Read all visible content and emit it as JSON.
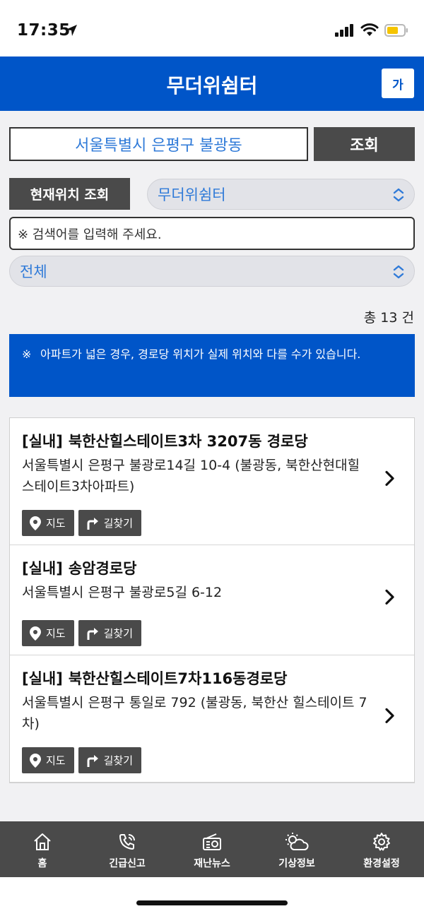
{
  "status_bar": {
    "time": "17:35"
  },
  "header": {
    "title": "무더위쉼터",
    "font_size_label": "가"
  },
  "search": {
    "value": "서울특별시 은평구 불광동",
    "button_label": "조회"
  },
  "location_button_label": "현재위치 조회",
  "shelter_type_select": {
    "selected": "무더위쉼터"
  },
  "keyword_input": {
    "placeholder": "※ 검색어를 입력해 주세요."
  },
  "category_select": {
    "selected": "전체"
  },
  "total_count": "총 13 건",
  "notice": {
    "mark": "※",
    "text": "아파트가 넓은 경우, 경로당 위치가 실제 위치와 다를 수가 있습니다."
  },
  "results": [
    {
      "tag": "[실내]",
      "name": "북한산힐스테이트3차 3207동 경로당",
      "address": "서울특별시 은평구 불광로14길 10-4 (불광동, 북한산현대힐스테이트3차아파트)",
      "map_label": "지도",
      "route_label": "길찾기"
    },
    {
      "tag": "[실내]",
      "name": "송암경로당",
      "address": "서울특별시 은평구 불광로5길 6-12",
      "map_label": "지도",
      "route_label": "길찾기"
    },
    {
      "tag": "[실내]",
      "name": "북한산힐스테이트7차116동경로당",
      "address": "서울특별시 은평구 통일로 792 (불광동, 북한산 힐스테이트 7차)",
      "map_label": "지도",
      "route_label": "길찾기"
    }
  ],
  "tab_bar": {
    "home": "홈",
    "emergency": "긴급신고",
    "disaster_news": "재난뉴스",
    "weather": "기상정보",
    "settings": "환경설정"
  },
  "colors": {
    "brand_blue": "#0055c8",
    "link_blue": "#2f7ad8",
    "dark_gray": "#4a4a4a",
    "battery_yellow": "#f5c400"
  }
}
